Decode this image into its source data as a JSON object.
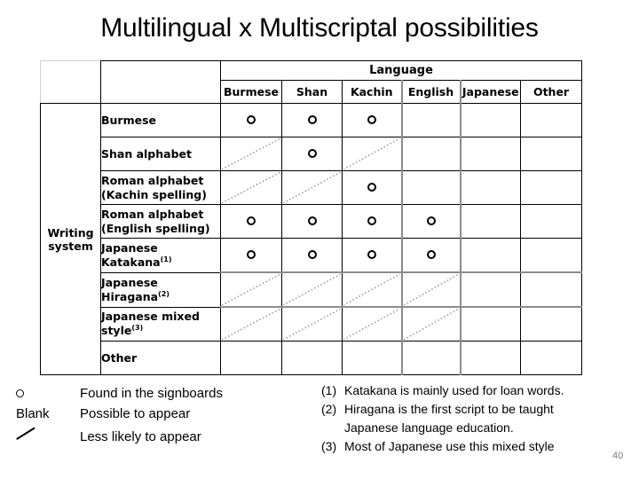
{
  "slide": {
    "title": "Multilingual x Multiscriptal possibilities",
    "number": "40"
  },
  "table": {
    "language_group_label": "Language",
    "writing_system_axis_label_line1": "Writing",
    "writing_system_axis_label_line2": "system",
    "columns": [
      "Burmese",
      "Shan",
      "Kachin",
      "English",
      "Japanese",
      "Other"
    ],
    "rows": [
      {
        "label_line1": "Burmese",
        "label_line2": "",
        "footnote": "",
        "cells": [
          "circle",
          "circle",
          "circle",
          "blank",
          "blank",
          "blank"
        ]
      },
      {
        "label_line1": "Shan alphabet",
        "label_line2": "",
        "footnote": "",
        "cells": [
          "diagonal",
          "circle",
          "diagonal",
          "blank",
          "blank",
          "blank"
        ]
      },
      {
        "label_line1": "Roman alphabet",
        "label_line2": "(Kachin spelling)",
        "footnote": "",
        "cells": [
          "diagonal",
          "diagonal",
          "circle",
          "blank",
          "blank",
          "blank"
        ]
      },
      {
        "label_line1": "Roman alphabet",
        "label_line2": "(English spelling)",
        "footnote": "",
        "cells": [
          "circle",
          "circle",
          "circle",
          "circle",
          "blank",
          "blank"
        ]
      },
      {
        "label_line1": "Japanese",
        "label_line2": "Katakana",
        "footnote": "(1)",
        "cells": [
          "circle",
          "circle",
          "circle",
          "circle",
          "blank",
          "blank"
        ]
      },
      {
        "label_line1": "Japanese",
        "label_line2": "Hiragana",
        "footnote": "(2)",
        "cells": [
          "diagonal",
          "diagonal",
          "diagonal",
          "diagonal",
          "blank",
          "blank"
        ]
      },
      {
        "label_line1": "Japanese mixed",
        "label_line2": "style",
        "footnote": "(3)",
        "cells": [
          "diagonal",
          "diagonal",
          "diagonal",
          "diagonal",
          "blank",
          "blank"
        ]
      },
      {
        "label_line1": "Other",
        "label_line2": "",
        "footnote": "",
        "cells": [
          "blank",
          "blank",
          "blank",
          "blank",
          "blank",
          "blank"
        ]
      }
    ]
  },
  "legend": [
    {
      "symbol": "circle",
      "symbol_text": "",
      "description": "Found in the signboards"
    },
    {
      "symbol": "text",
      "symbol_text": "Blank",
      "description": "Possible to appear"
    },
    {
      "symbol": "slash",
      "symbol_text": "",
      "description": "Less likely to appear"
    }
  ],
  "footnotes": [
    {
      "number": "(1)",
      "line1": "Katakana is mainly used for loan words.",
      "line2": ""
    },
    {
      "number": "(2)",
      "line1": "Hiragana is the first script to be taught",
      "line2": "Japanese language education."
    },
    {
      "number": "(3)",
      "line1": "Most of Japanese use this mixed style",
      "line2": ""
    }
  ]
}
